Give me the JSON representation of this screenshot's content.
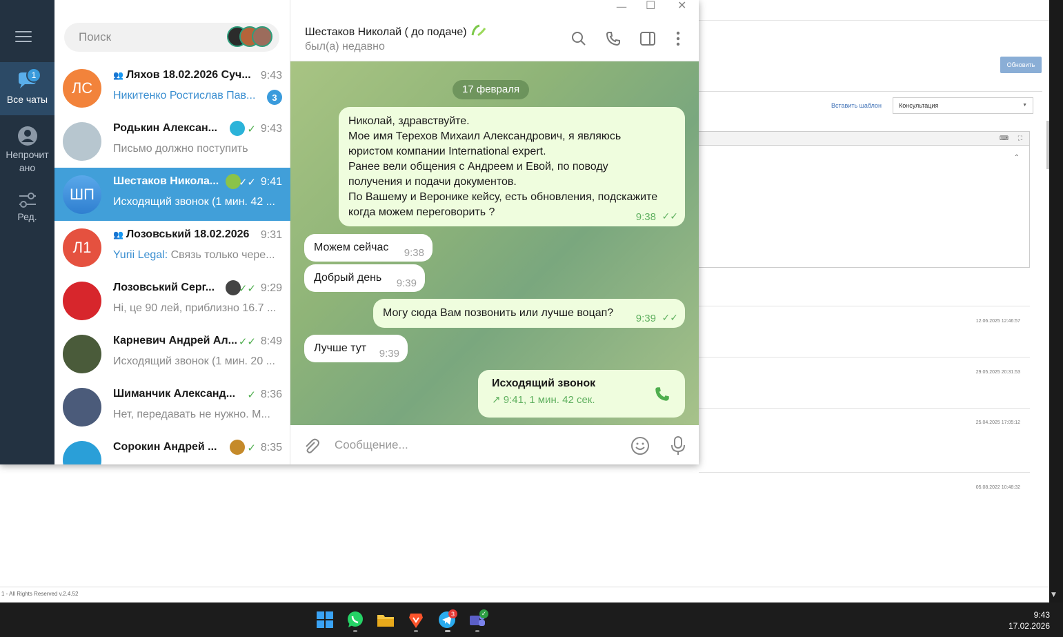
{
  "background_app": {
    "refresh_button": "Обновить",
    "insert_template_link": "Вставить шаблон",
    "template_select_value": "Консультация",
    "timestamps": [
      "12.06.2025 12:46:57",
      "29.05.2025 20:31:53",
      "25.04.2025 17:05:12",
      "05.08.2022 10:48:32"
    ],
    "footer": "1 - All Rights Reserved v.2.4.52"
  },
  "rail": {
    "all_chats_label": "Все чаты",
    "all_chats_badge": "1",
    "unread_label_line1": "Непрочит",
    "unread_label_line2": "ано",
    "edit_label": "Ред."
  },
  "search": {
    "placeholder": "Поиск"
  },
  "chats": [
    {
      "initials": "ЛС",
      "avatar_color": "#f2833b",
      "name": "Ляхов 18.02.2026 Суч...",
      "time": "9:43",
      "sender": "Никитенко Ростислав Пав...",
      "preview": "",
      "unread": "3",
      "group": true
    },
    {
      "initials": "",
      "avatar_color": "#b7c6cf",
      "name": "Родькин Алексан...",
      "time": "9:43",
      "preview": "Письмо должно поступить",
      "status": "✓",
      "emoji": "palm"
    },
    {
      "initials": "ШП",
      "avatar_color": "#3b8fd9",
      "name": "Шестаков Никола...",
      "time": "9:41",
      "preview": "Исходящий звонок (1 мин. 42 ...",
      "status": "✓✓",
      "active": true
    },
    {
      "initials": "Л1",
      "avatar_color": "#e5513f",
      "name": "Лозовський 18.02.2026",
      "time": "9:31",
      "sender": "Yurii Legal:",
      "preview": " Связь только чере...",
      "group": true
    },
    {
      "initials": "",
      "avatar_color": "#d7262c",
      "name": "Лозовський Серг...",
      "time": "9:29",
      "preview": "Hi, це 90 лей, приблизно 16.7 ...",
      "status": "✓✓"
    },
    {
      "initials": "",
      "avatar_color": "#4a5b3a",
      "name": "Карневич Андрей Ал...",
      "time": "8:49",
      "preview": "Исходящий звонок (1 мин. 20 ...",
      "status": "✓✓"
    },
    {
      "initials": "",
      "avatar_color": "#4b5b7a",
      "name": "Шиманчик Александ...",
      "time": "8:36",
      "preview": "Нет, передавать не нужно. М...",
      "status": "✓"
    },
    {
      "initials": "",
      "avatar_color": "#2a9fd8",
      "name": "Сорокин Андрей ...",
      "time": "8:35",
      "preview": "",
      "status": "✓"
    }
  ],
  "conversation": {
    "name": "Шестаков Николай ( до подаче)",
    "status": "был(а) недавно",
    "date": "17 февраля",
    "messages": [
      {
        "dir": "out",
        "lines": [
          "Николай, здравствуйте.",
          "Мое имя Терехов Михаил Александрович, я являюсь",
          "юристом компании International expert.",
          "Ранее вели общения с Андреем и Евой, по поводу",
          "получения и подачи документов.",
          "По Вашему и Веронике кейсу, есть обновления, подскажите",
          "когда можем переговорить ?"
        ],
        "time": "9:38",
        "check": "✓✓"
      },
      {
        "dir": "in",
        "text": "Можем сейчас",
        "time": "9:38"
      },
      {
        "dir": "in",
        "text": "Добрый день",
        "time": "9:39"
      },
      {
        "dir": "out",
        "text": "Могу сюда Вам позвонить или лучше воцап?",
        "time": "9:39",
        "check": "✓✓"
      },
      {
        "dir": "in",
        "text": "Лучше тут",
        "time": "9:39"
      }
    ],
    "call": {
      "title": "Исходящий звонок",
      "detail": "9:41, 1 мин. 42 сек."
    },
    "composer_placeholder": "Сообщение..."
  },
  "taskbar": {
    "time": "9:43",
    "date": "17.02.2026",
    "telegram_badge": "3"
  }
}
